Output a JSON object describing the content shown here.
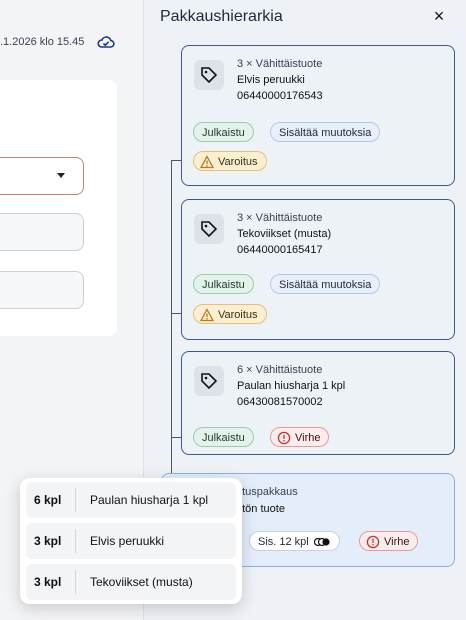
{
  "left": {
    "saved_text": ".1.2026 klo 15.45",
    "cloud_icon": "cloud-check-icon"
  },
  "panel": {
    "title": "Pakkaushierarkia",
    "close_label": "×"
  },
  "cards": [
    {
      "qty_label": "3 × Vähittäistuote",
      "name": "Elvis peruukki",
      "code": "06440000176543",
      "badges": [
        "Julkaistu",
        "Sisältää muutoksia",
        "Varoitus"
      ]
    },
    {
      "qty_label": "3 × Vähittäistuote",
      "name": "Tekoviikset (musta)",
      "code": "06440000165417",
      "badges": [
        "Julkaistu",
        "Sisältää muutoksia",
        "Varoitus"
      ]
    },
    {
      "qty_label": "6 × Vähittäistuote",
      "name": "Paulan hiusharja 1 kpl",
      "code": "06430081570002",
      "badges": [
        "Julkaistu",
        "Virhe"
      ]
    },
    {
      "qty_label": "etuspakkaus",
      "name": "etön tuote",
      "badges": [
        "Sis. 12 kpl",
        "Virhe"
      ]
    }
  ],
  "popup": {
    "rows": [
      {
        "qty": "6 kpl",
        "name": "Paulan hiusharja 1 kpl"
      },
      {
        "qty": "3 kpl",
        "name": "Elvis peruukki"
      },
      {
        "qty": "3 kpl",
        "name": "Tekoviikset (musta)"
      }
    ]
  },
  "colors": {
    "card_border": "#3b5b8c",
    "published": "#e3f3ea",
    "warning": "#fbefcf",
    "error": "#fdecec"
  }
}
